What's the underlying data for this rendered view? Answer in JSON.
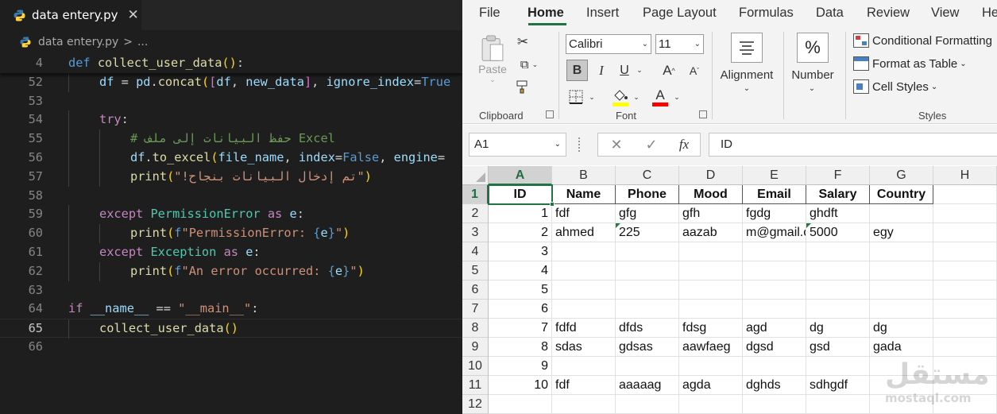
{
  "vscode": {
    "tab": {
      "label": "data entery.py",
      "close": "✕"
    },
    "breadcrumb": {
      "file": "data entery.py",
      "sep": ">",
      "rest": "..."
    },
    "lines": [
      {
        "n": "4",
        "sticky": true,
        "parts": [
          [
            "kw",
            "def "
          ],
          [
            "fn",
            "collect_user_data"
          ],
          [
            "br1",
            "()"
          ],
          [
            "pu",
            ":"
          ]
        ]
      },
      {
        "n": "52",
        "indent": 1,
        "parts": [
          [
            "var",
            "df"
          ],
          [
            "pu",
            " = "
          ],
          [
            "var",
            "pd"
          ],
          [
            "pu",
            "."
          ],
          [
            "fn",
            "concat"
          ],
          [
            "br1",
            "("
          ],
          [
            "br2",
            "["
          ],
          [
            "var",
            "df"
          ],
          [
            "pu",
            ", "
          ],
          [
            "var",
            "new_data"
          ],
          [
            "br2",
            "]"
          ],
          [
            "pu",
            ", "
          ],
          [
            "var",
            "ignore_index"
          ],
          [
            "pu",
            "="
          ],
          [
            "kw",
            "True"
          ]
        ]
      },
      {
        "n": "53",
        "parts": []
      },
      {
        "n": "54",
        "indent": 1,
        "parts": [
          [
            "ctl",
            "try"
          ],
          [
            "pu",
            ":"
          ]
        ]
      },
      {
        "n": "55",
        "indent": 2,
        "parts": [
          [
            "cm",
            "# حفظ البيانات إلى ملف Excel"
          ]
        ]
      },
      {
        "n": "56",
        "indent": 2,
        "parts": [
          [
            "var",
            "df"
          ],
          [
            "pu",
            "."
          ],
          [
            "fn",
            "to_excel"
          ],
          [
            "br1",
            "("
          ],
          [
            "var",
            "file_name"
          ],
          [
            "pu",
            ", "
          ],
          [
            "var",
            "index"
          ],
          [
            "pu",
            "="
          ],
          [
            "kw",
            "False"
          ],
          [
            "pu",
            ", "
          ],
          [
            "var",
            "engine"
          ],
          [
            "pu",
            "="
          ]
        ]
      },
      {
        "n": "57",
        "indent": 2,
        "parts": [
          [
            "fn",
            "print"
          ],
          [
            "br1",
            "("
          ],
          [
            "str",
            "\"!تم إدخال البيانات بنجاح\""
          ],
          [
            "br1",
            ")"
          ]
        ]
      },
      {
        "n": "58",
        "parts": []
      },
      {
        "n": "59",
        "indent": 1,
        "parts": [
          [
            "ctl",
            "except "
          ],
          [
            "cls",
            "PermissionError"
          ],
          [
            "ctl",
            " as "
          ],
          [
            "var",
            "e"
          ],
          [
            "pu",
            ":"
          ]
        ]
      },
      {
        "n": "60",
        "indent": 2,
        "parts": [
          [
            "fn",
            "print"
          ],
          [
            "br1",
            "("
          ],
          [
            "kw",
            "f"
          ],
          [
            "str",
            "\"PermissionError: "
          ],
          [
            "kw",
            "{"
          ],
          [
            "var",
            "e"
          ],
          [
            "kw",
            "}"
          ],
          [
            "str",
            "\""
          ],
          [
            "br1",
            ")"
          ]
        ]
      },
      {
        "n": "61",
        "indent": 1,
        "parts": [
          [
            "ctl",
            "except "
          ],
          [
            "cls",
            "Exception"
          ],
          [
            "ctl",
            " as "
          ],
          [
            "var",
            "e"
          ],
          [
            "pu",
            ":"
          ]
        ]
      },
      {
        "n": "62",
        "indent": 2,
        "parts": [
          [
            "fn",
            "print"
          ],
          [
            "br1",
            "("
          ],
          [
            "kw",
            "f"
          ],
          [
            "str",
            "\"An error occurred: "
          ],
          [
            "kw",
            "{"
          ],
          [
            "var",
            "e"
          ],
          [
            "kw",
            "}"
          ],
          [
            "str",
            "\""
          ],
          [
            "br1",
            ")"
          ]
        ]
      },
      {
        "n": "63",
        "parts": []
      },
      {
        "n": "64",
        "parts": [
          [
            "ctl",
            "if "
          ],
          [
            "var",
            "__name__"
          ],
          [
            "pu",
            " == "
          ],
          [
            "str",
            "\"__main__\""
          ],
          [
            "pu",
            ":"
          ]
        ]
      },
      {
        "n": "65",
        "indent": 1,
        "current": true,
        "parts": [
          [
            "fn",
            "collect_user_data"
          ],
          [
            "br1",
            "()"
          ]
        ]
      },
      {
        "n": "66",
        "parts": []
      }
    ],
    "colors": {
      "background": "#1e1e1e",
      "keyword": "#569cd6",
      "string": "#ce9178",
      "comment": "#6a9955"
    }
  },
  "excel": {
    "tabs": [
      "File",
      "Home",
      "Insert",
      "Page Layout",
      "Formulas",
      "Data",
      "Review",
      "View",
      "He"
    ],
    "active_tab": "Home",
    "clipboard": {
      "paste": "Paste",
      "group": "Clipboard"
    },
    "font": {
      "name": "Calibri",
      "size": "11",
      "group": "Font",
      "bold": "B",
      "italic": "I",
      "underline": "U",
      "grow": "A",
      "shrink": "A"
    },
    "alignment": {
      "label": "Alignment"
    },
    "number": {
      "label": "Number",
      "symbol": "%"
    },
    "styles": {
      "conditional": "Conditional Formatting",
      "table": "Format as Table",
      "cell": "Cell Styles",
      "group": "Styles"
    },
    "name_box": "A1",
    "formula": "ID",
    "fx": "fx",
    "columns": [
      "A",
      "B",
      "C",
      "D",
      "E",
      "F",
      "G",
      "H"
    ],
    "rows": [
      "1",
      "2",
      "3",
      "4",
      "5",
      "6",
      "7",
      "8",
      "9",
      "10",
      "11",
      "12"
    ],
    "table": [
      [
        "ID",
        "Name",
        "Phone",
        "Mood",
        "Email",
        "Salary",
        "Country",
        ""
      ],
      [
        "1",
        "fdf",
        "gfg",
        "gfh",
        "fgdg",
        "ghdft",
        "",
        ""
      ],
      [
        "2",
        "ahmed",
        "225",
        "aazab",
        "m@gmail.c",
        "5000",
        "egy",
        ""
      ],
      [
        "3",
        "",
        "",
        "",
        "",
        "",
        "",
        ""
      ],
      [
        "4",
        "",
        "",
        "",
        "",
        "",
        "",
        ""
      ],
      [
        "5",
        "",
        "",
        "",
        "",
        "",
        "",
        ""
      ],
      [
        "6",
        "",
        "",
        "",
        "",
        "",
        "",
        ""
      ],
      [
        "7",
        "fdfd",
        "dfds",
        "fdsg",
        "agd",
        "dg",
        "dg",
        ""
      ],
      [
        "8",
        "sdas",
        "gdsas",
        "aawfaeg",
        "dgsd",
        "gsd",
        "gada",
        ""
      ],
      [
        "9",
        "",
        "",
        "",
        "",
        "",
        "",
        ""
      ],
      [
        "10",
        "fdf",
        "aaaaag",
        "agda",
        "dghds",
        "sdhgdf",
        "",
        ""
      ],
      [
        "",
        "",
        "",
        "",
        "",
        "",
        "",
        ""
      ]
    ],
    "accent": "#217346"
  },
  "watermark": {
    "arabic": "مستقل",
    "latin": "mostaql.com"
  }
}
